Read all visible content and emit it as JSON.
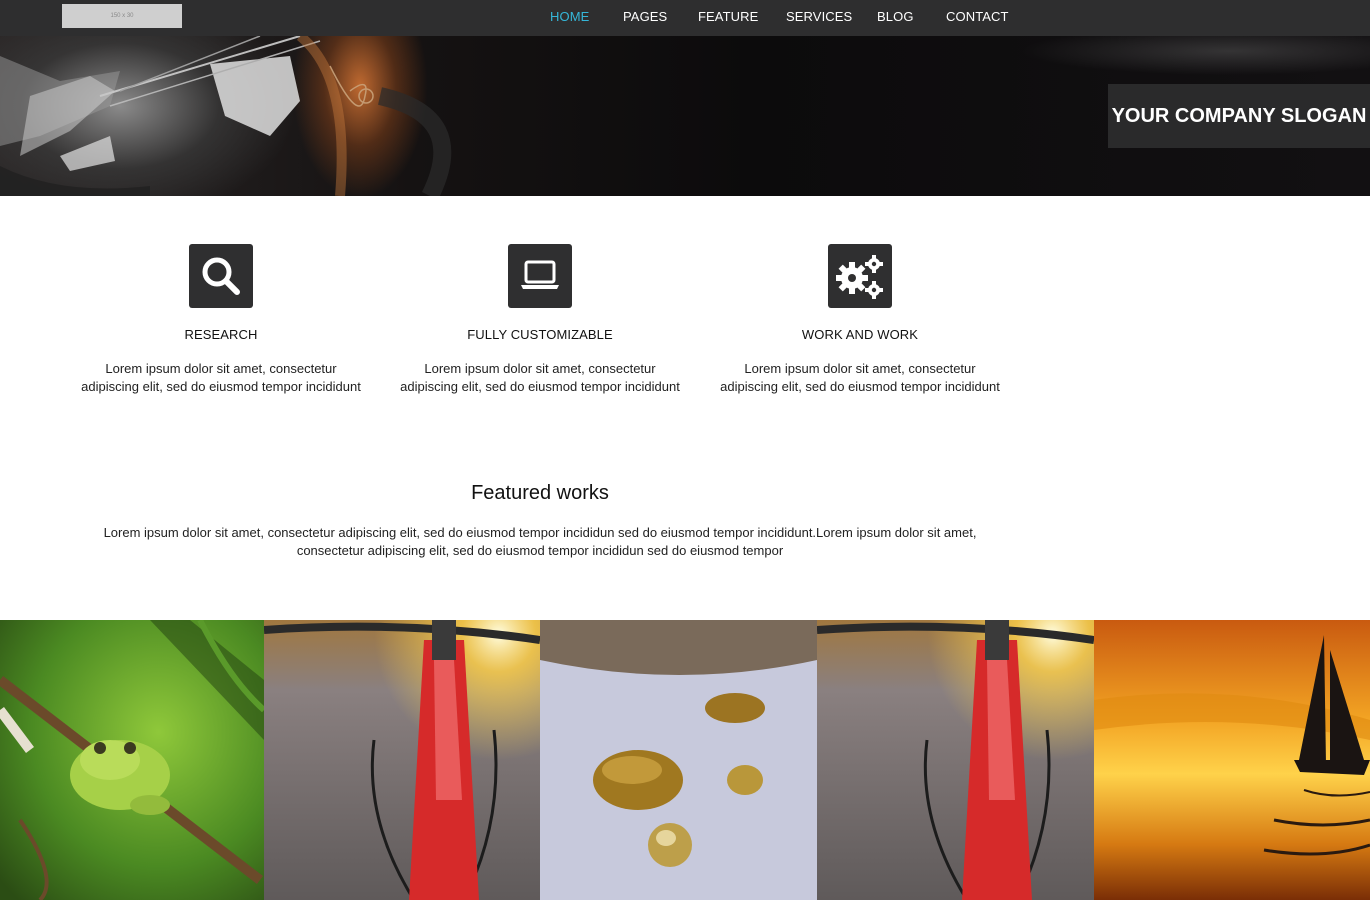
{
  "navbar": {
    "logo_text": "150 x 30",
    "items": [
      {
        "label": "HOME",
        "active": true
      },
      {
        "label": "PAGES",
        "active": false
      },
      {
        "label": "FEATURE",
        "active": false
      },
      {
        "label": "SERVICES",
        "active": false
      },
      {
        "label": "BLOG",
        "active": false
      },
      {
        "label": "CONTACT",
        "active": false
      }
    ],
    "active_color": "#35b6d8"
  },
  "hero": {
    "slogan": "YOUR COMPANY SLOGAN"
  },
  "features": [
    {
      "icon": "search-icon",
      "title": "RESEARCH",
      "desc_line1": "Lorem ipsum dolor sit amet, consectetur",
      "desc_line2": "adipiscing elit, sed do eiusmod tempor incididunt"
    },
    {
      "icon": "laptop-icon",
      "title": "FULLY CUSTOMIZABLE",
      "desc_line1": "Lorem ipsum dolor sit amet, consectetur",
      "desc_line2": "adipiscing elit, sed do eiusmod tempor incididunt"
    },
    {
      "icon": "gears-icon",
      "title": "WORK AND WORK",
      "desc_line1": "Lorem ipsum dolor sit amet, consectetur",
      "desc_line2": "adipiscing elit, sed do eiusmod tempor incididunt"
    }
  ],
  "featured": {
    "title": "Featured works",
    "desc_line1": "Lorem ipsum dolor sit amet, consectetur adipiscing elit, sed do eiusmod tempor incididun sed do eiusmod tempor incididunt.Lorem ipsum dolor sit amet,",
    "desc_line2": "consectetur adipiscing elit, sed do eiusmod tempor incididun sed do eiusmod tempor"
  },
  "gallery": [
    {
      "subject": "frog"
    },
    {
      "subject": "bicycle"
    },
    {
      "subject": "water-drops"
    },
    {
      "subject": "bicycle"
    },
    {
      "subject": "sailboat-sunset"
    }
  ]
}
